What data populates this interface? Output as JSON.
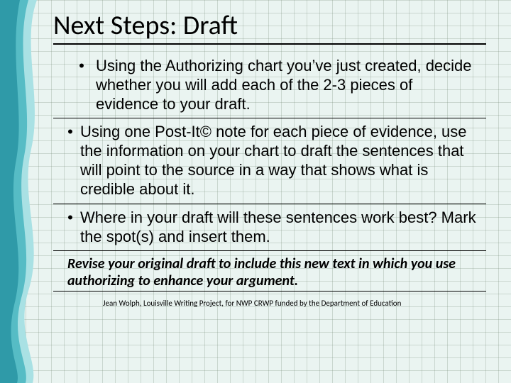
{
  "title": "Next Steps:  Draft",
  "bullets": [
    "Using the Authorizing chart you’ve just created, decide whether you will add each of the 2-3 pieces of evidence to your draft.",
    "Using one Post-It© note for each piece of evidence, use the information on your chart to draft the sentences that will point to the source in a way that shows what is credible about it.",
    "Where in your draft will these sentences work best?  Mark the spot(s) and insert them."
  ],
  "revise": "Revise your original draft to include this new text in which you use authorizing to enhance your argument.",
  "footer": "Jean Wolph, Louisville Writing Project, for NWP CRWP funded by the Department of Education",
  "colors": {
    "waveDark": "#2f9aa8",
    "waveMid": "#56bcc5",
    "waveLight": "#a9e1e4"
  }
}
